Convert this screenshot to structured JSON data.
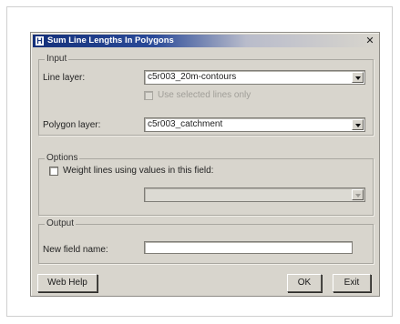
{
  "dialog": {
    "title": "Sum Line Lengths In Polygons",
    "app_icon_letter": "H",
    "close_glyph": "✕"
  },
  "input_group": {
    "legend": "Input",
    "line_layer_label": "Line layer:",
    "line_layer_value": "c5r003_20m-contours",
    "use_selected_label": "Use selected lines only",
    "use_selected_checked": false,
    "use_selected_enabled": false,
    "polygon_layer_label": "Polygon layer:",
    "polygon_layer_value": "c5r003_catchment"
  },
  "options_group": {
    "legend": "Options",
    "weight_label": "Weight lines using values in this field:",
    "weight_checked": false,
    "field_value": "",
    "field_enabled": false
  },
  "output_group": {
    "legend": "Output",
    "new_field_label": "New field name:",
    "new_field_value": ""
  },
  "buttons": {
    "web_help": "Web Help",
    "ok": "OK",
    "exit": "Exit"
  },
  "colors": {
    "title_bar": "#14307a",
    "dialog_face": "#d8d5cd"
  }
}
